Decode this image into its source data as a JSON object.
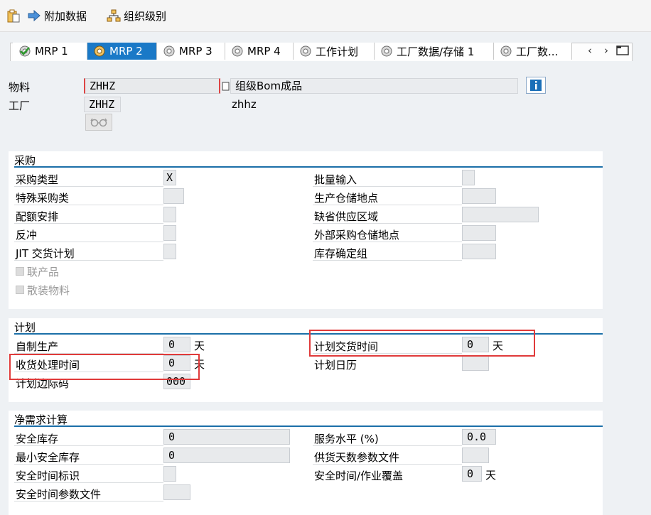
{
  "toolbar": {
    "append_data_label": "附加数据",
    "org_levels_label": "组织级别"
  },
  "tabs": [
    {
      "label": "MRP 1"
    },
    {
      "label": "MRP 2"
    },
    {
      "label": "MRP 3"
    },
    {
      "label": "MRP 4"
    },
    {
      "label": "工作计划"
    },
    {
      "label": "工厂数据/存储 1"
    },
    {
      "label": "工厂数..."
    }
  ],
  "header": {
    "material_label": "物料",
    "material_value": "ZHHZ",
    "material_desc": "组级Bom成品",
    "plant_label": "工厂",
    "plant_value": "ZHHZ",
    "plant_desc": "zhhz"
  },
  "procurement": {
    "title": "采购",
    "procurement_type_label": "采购类型",
    "procurement_type_value": "X",
    "special_procurement_label": "特殊采购类",
    "quota_arrangement_label": "配额安排",
    "backflush_label": "反冲",
    "jit_schedule_label": "JIT 交货计划",
    "co_product_label": "联产品",
    "bulk_material_label": "散装物料",
    "batch_entry_label": "批量输入",
    "prod_storage_loc_label": "生产仓储地点",
    "default_supply_area_label": "缺省供应区域",
    "ext_proc_storage_loc_label": "外部采购仓储地点",
    "stock_det_group_label": "库存确定组"
  },
  "scheduling": {
    "title": "计划",
    "inhouse_production_label": "自制生产",
    "inhouse_production_value": "0",
    "gr_processing_time_label": "收货处理时间",
    "gr_processing_time_value": "0",
    "sm_key_label": "计划边际码",
    "sm_key_value": "000",
    "planned_delivery_time_label": "计划交货时间",
    "planned_delivery_time_value": "0",
    "planning_calendar_label": "计划日历",
    "unit_days": "天"
  },
  "net_requirements": {
    "title": "净需求计算",
    "safety_stock_label": "安全库存",
    "safety_stock_value": "0",
    "min_safety_stock_label": "最小安全库存",
    "min_safety_stock_value": "0",
    "safety_time_ind_label": "安全时间标识",
    "safety_time_profile_label": "安全时间参数文件",
    "service_level_label": "服务水平 (%)",
    "service_level_value": "0.0",
    "coverage_profile_label": "供货天数参数文件",
    "safety_time_coverage_label": "安全时间/作业覆盖",
    "safety_time_coverage_value": "0",
    "unit_days": "天"
  },
  "colors": {
    "accent": "#1a79c7",
    "group_line": "#1b6fa8",
    "highlight": "#e03a3a"
  }
}
